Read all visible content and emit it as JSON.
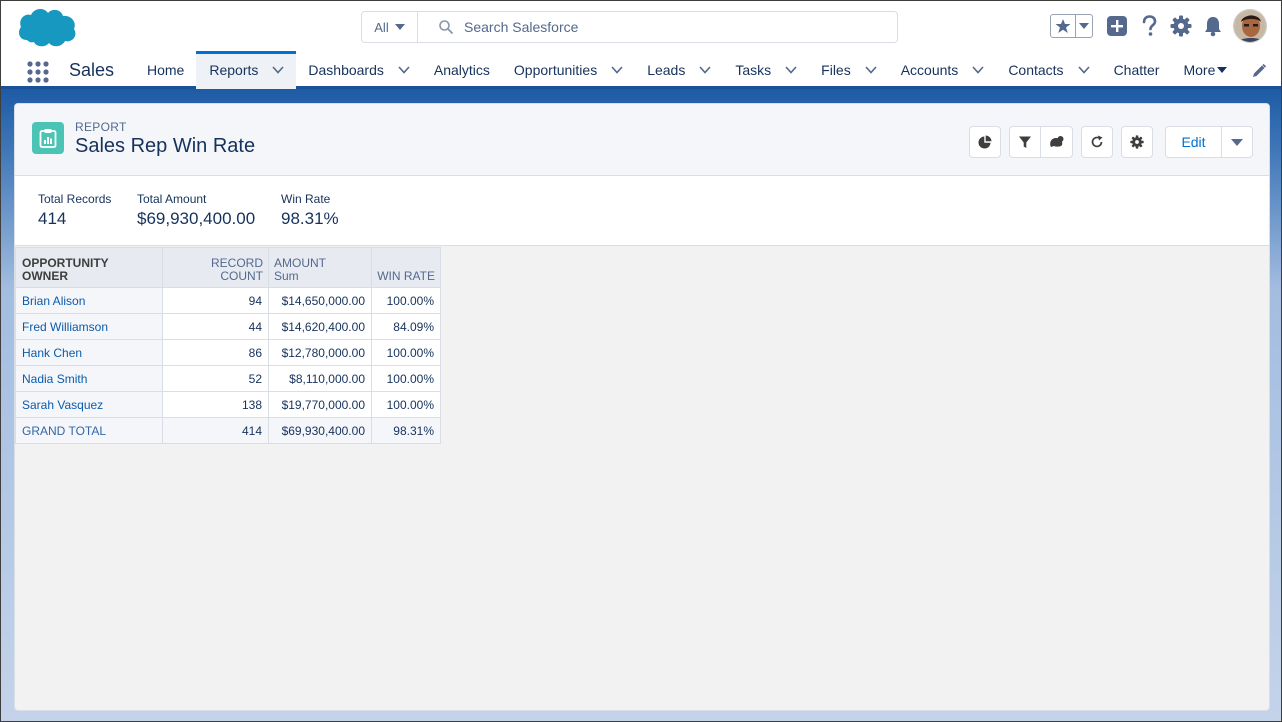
{
  "header": {
    "search_scope": "All",
    "search_placeholder": "Search Salesforce",
    "icons": [
      "favorites-star-icon",
      "add-plus-icon",
      "help-icon",
      "setup-gear-icon",
      "notifications-bell-icon"
    ]
  },
  "nav": {
    "app_name": "Sales",
    "items": [
      {
        "label": "Home",
        "dropdown": false
      },
      {
        "label": "Reports",
        "dropdown": true,
        "active": true
      },
      {
        "label": "Dashboards",
        "dropdown": true
      },
      {
        "label": "Analytics",
        "dropdown": false
      },
      {
        "label": "Opportunities",
        "dropdown": true
      },
      {
        "label": "Leads",
        "dropdown": true
      },
      {
        "label": "Tasks",
        "dropdown": true
      },
      {
        "label": "Files",
        "dropdown": true
      },
      {
        "label": "Accounts",
        "dropdown": true
      },
      {
        "label": "Contacts",
        "dropdown": true
      },
      {
        "label": "Chatter",
        "dropdown": false
      }
    ],
    "more_label": "More"
  },
  "report": {
    "kicker": "REPORT",
    "title": "Sales Rep Win Rate",
    "edit_label": "Edit",
    "colors": {
      "icon_bg": "#4bc3b5",
      "brand_blue": "#0070d2",
      "nav_border": "#1b5297"
    }
  },
  "summary": [
    {
      "label": "Total Records",
      "value": "414"
    },
    {
      "label": "Total Amount",
      "value": "$69,930,400.00"
    },
    {
      "label": "Win Rate",
      "value": "98.31%"
    }
  ],
  "table": {
    "headers": [
      "OPPORTUNITY OWNER",
      "RECORD COUNT",
      "AMOUNT",
      "Sum",
      "WIN RATE"
    ],
    "rows": [
      {
        "owner": "Brian Alison",
        "count": "94",
        "amount": "$14,650,000.00",
        "win_rate": "100.00%"
      },
      {
        "owner": "Fred Williamson",
        "count": "44",
        "amount": "$14,620,400.00",
        "win_rate": "84.09%"
      },
      {
        "owner": "Hank Chen",
        "count": "86",
        "amount": "$12,780,000.00",
        "win_rate": "100.00%"
      },
      {
        "owner": "Nadia Smith",
        "count": "52",
        "amount": "$8,110,000.00",
        "win_rate": "100.00%"
      },
      {
        "owner": "Sarah Vasquez",
        "count": "138",
        "amount": "$19,770,000.00",
        "win_rate": "100.00%"
      }
    ],
    "total": {
      "owner": "GRAND TOTAL",
      "count": "414",
      "amount": "$69,930,400.00",
      "win_rate": "98.31%"
    }
  }
}
